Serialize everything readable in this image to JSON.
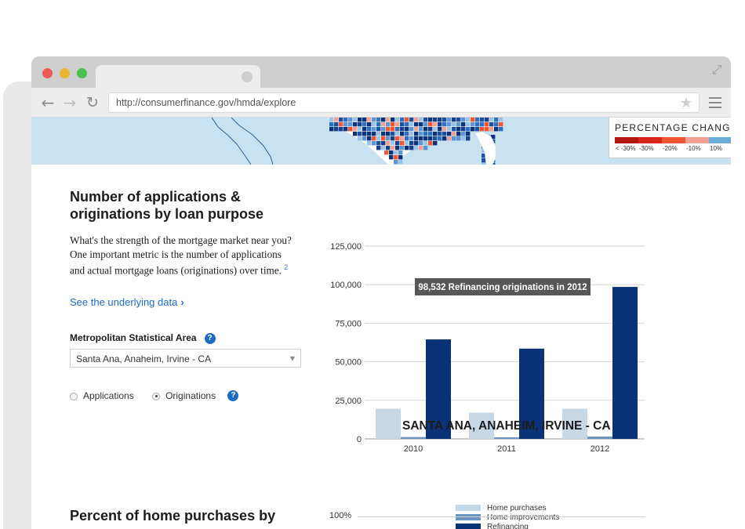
{
  "browser": {
    "url": "http://consumerfinance.gov/hmda/explore"
  },
  "map_legend": {
    "title": "PERCENTAGE CHANGE",
    "swatch_colors": [
      "#b2170f",
      "#d9261a",
      "#ef5633",
      "#f4a093",
      "#6aacd8"
    ],
    "ticks": [
      "< -30%",
      "-30%",
      "-20%",
      "-10%",
      "10%"
    ]
  },
  "section1": {
    "title": "Number of applications & originations by loan purpose",
    "intro": "What's the strength of the mortgage market near you? One important metric is the number of applications and actual mortgage loans (originations) over time.",
    "footnote": "2",
    "data_link": "See the underlying data",
    "msa_label": "Metropolitan Statistical Area",
    "msa_value": "Santa Ana, Anaheim, Irvine - CA",
    "radio_applications": "Applications",
    "radio_originations": "Originations"
  },
  "chart_data": {
    "type": "bar",
    "title": "SANTA ANA, ANAHEIM, IRVINE - CA",
    "categories": [
      "2010",
      "2011",
      "2012"
    ],
    "series": [
      {
        "name": "Home purchases",
        "values": [
          19500,
          17000,
          19500
        ],
        "color": "#c6d7e6"
      },
      {
        "name": "Home improvements",
        "values": [
          1200,
          1000,
          1500
        ],
        "color": "#6a95c1"
      },
      {
        "name": "Refinancing",
        "values": [
          64500,
          58500,
          98532
        ],
        "color": "#0a3279"
      }
    ],
    "ylim": [
      0,
      125000
    ],
    "yticks": [
      "0",
      "25,000",
      "50,000",
      "75,000",
      "100,000",
      "125,000"
    ],
    "grid": true,
    "tooltip": "98,532 Refinancing originations in 2012",
    "legend_position": "bottom"
  },
  "section2": {
    "title": "Percent of home purchases by",
    "axis_top_label": "100%"
  }
}
